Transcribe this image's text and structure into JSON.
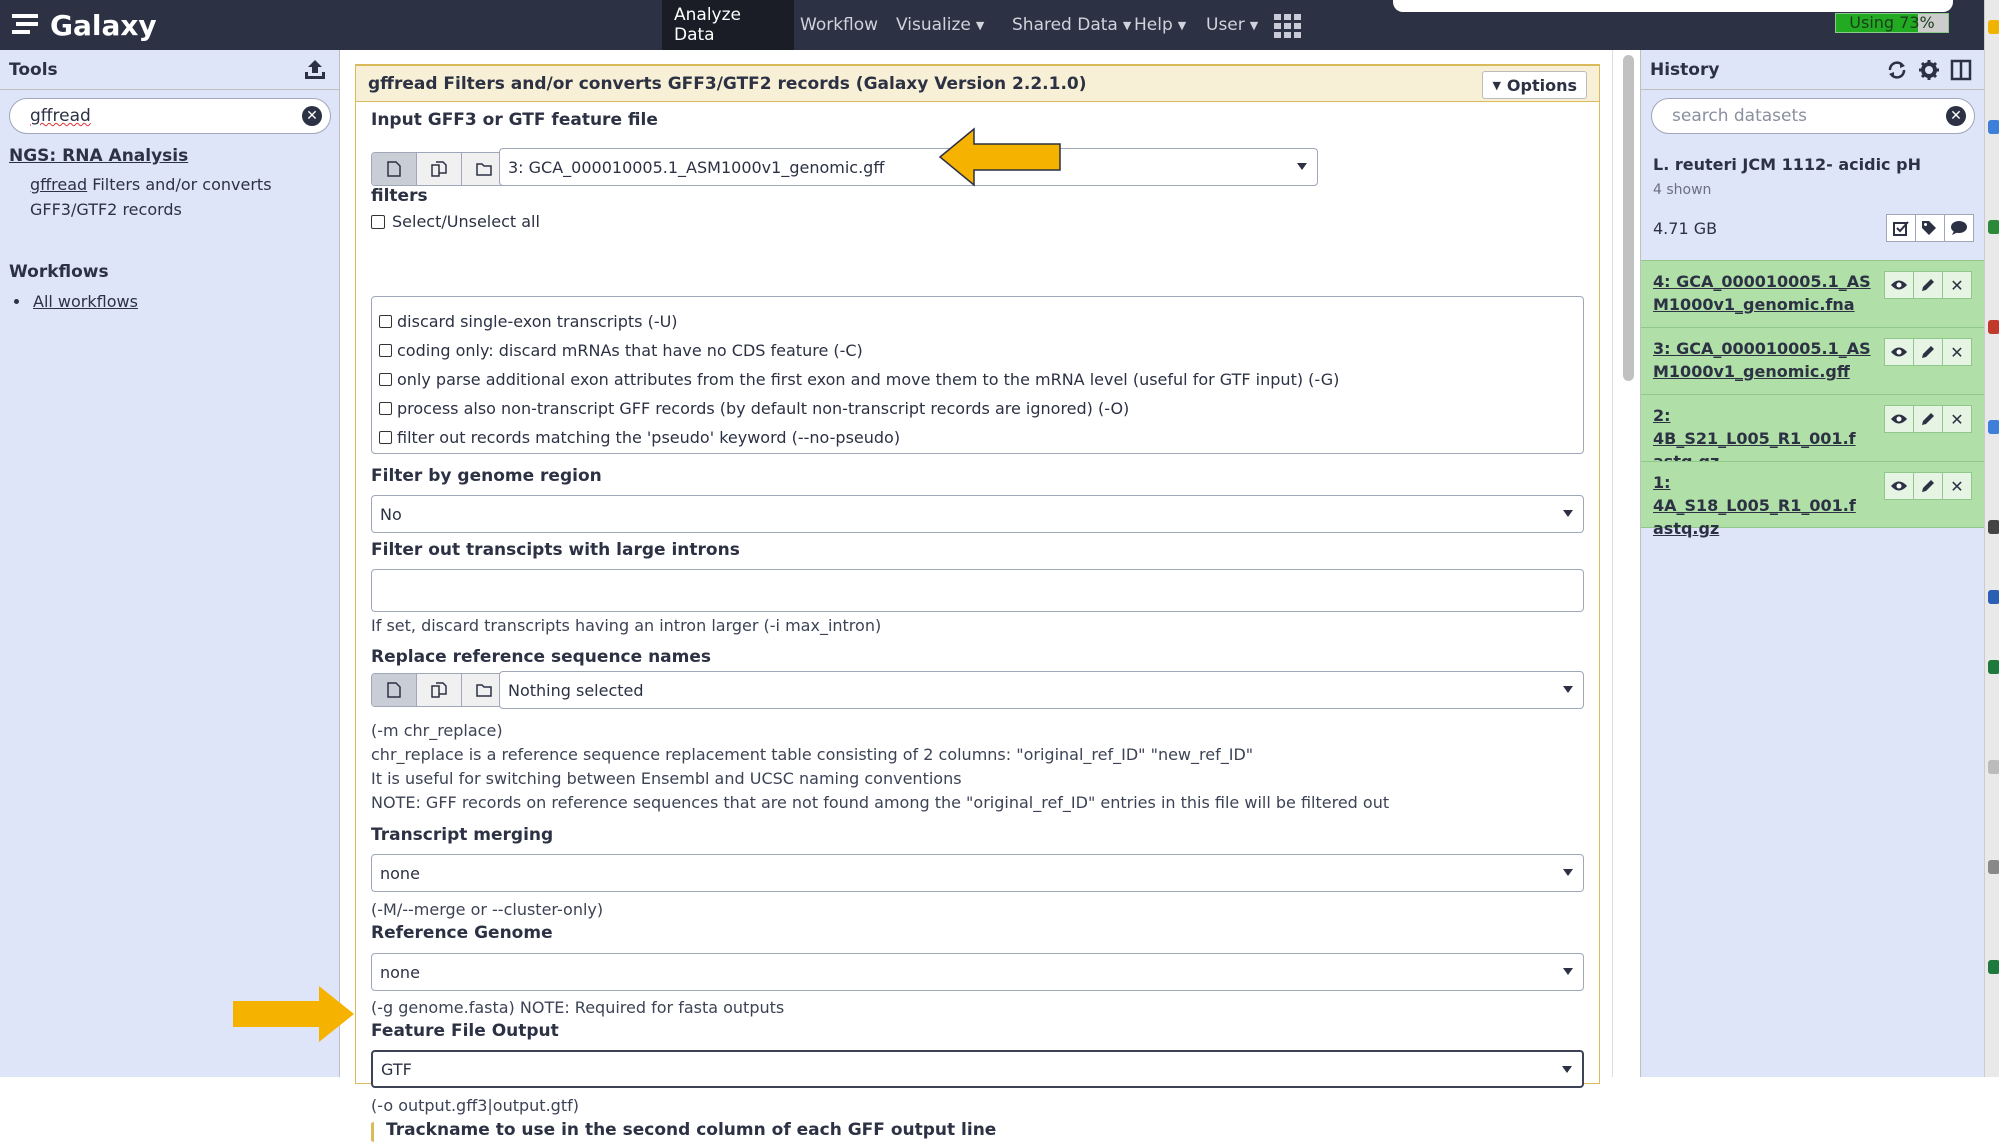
{
  "masthead": {
    "brand": "Galaxy",
    "nav": [
      {
        "label": "Analyze Data",
        "dropdown": false,
        "active": true
      },
      {
        "label": "Workflow",
        "dropdown": false,
        "active": false
      },
      {
        "label": "Visualize",
        "dropdown": true,
        "active": false
      },
      {
        "label": "Shared Data",
        "dropdown": true,
        "active": false
      },
      {
        "label": "Help",
        "dropdown": true,
        "active": false
      },
      {
        "label": "User",
        "dropdown": true,
        "active": false
      }
    ],
    "quota": "Using 73%",
    "quota_percent": 73
  },
  "tools": {
    "title": "Tools",
    "search_value": "gffread",
    "section": "NGS: RNA Analysis",
    "tool_link": "gffread",
    "tool_desc": " Filters and/or converts GFF3/GTF2 records",
    "workflows_title": "Workflows",
    "all_workflows": "All workflows"
  },
  "form": {
    "title": "gffread Filters and/or converts GFF3/GTF2 records (Galaxy Version 2.2.1.0)",
    "options_label": "Options",
    "input_label": "Input GFF3 or GTF feature file",
    "input_value": "3: GCA_000010005.1_ASM1000v1_genomic.gff",
    "filters_label": "filters",
    "select_all": "Select/Unselect all",
    "filters": [
      "discard single-exon transcripts (-U)",
      "coding only: discard mRNAs that have no CDS feature (-C)",
      "only parse additional exon attributes from the first exon and move them to the mRNA level (useful for GTF input) (-G)",
      "process also non-transcript GFF records (by default non-transcript records are ignored) (-O)",
      "filter out records matching the 'pseudo' keyword (--no-pseudo)"
    ],
    "region_label": "Filter by genome region",
    "region_value": "No",
    "introns_label": "Filter out transcipts with large introns",
    "introns_help": "If set, discard transcripts having an intron larger (-i max_intron)",
    "replace_label": "Replace reference sequence names",
    "replace_value": "Nothing selected",
    "replace_help": [
      "(-m chr_replace)",
      "chr_replace is a reference sequence replacement table consisting of 2 columns: \"original_ref_ID\" \"new_ref_ID\"",
      "It is useful for switching between Ensembl and UCSC naming conventions",
      "NOTE: GFF records on reference sequences that are not found among the \"original_ref_ID\" entries in this file will be filtered out"
    ],
    "merge_label": "Transcript merging",
    "merge_value": "none",
    "merge_help": "(-M/--merge or --cluster-only)",
    "genome_label": "Reference Genome",
    "genome_value": "none",
    "genome_help": "(-g genome.fasta) NOTE: Required for fasta outputs",
    "output_label": "Feature File Output",
    "output_value": "GTF",
    "output_help": "(-o output.gff3|output.gtf)",
    "trackname_label": "Trackname to use in the second column of each GFF output line"
  },
  "history": {
    "title": "History",
    "search_placeholder": "search datasets",
    "name": "L. reuteri JCM 1112- acidic pH",
    "shown": "4 shown",
    "size": "4.71 GB",
    "datasets": [
      {
        "line1": "4: GCA_000010005.1_AS",
        "line2": "M1000v1_genomic.fna"
      },
      {
        "line1": "3: GCA_000010005.1_AS",
        "line2": "M1000v1_genomic.gff"
      },
      {
        "line1": "2: 4B_S21_L005_R1_001.f",
        "line2": "astq.gz"
      },
      {
        "line1": "1: 4A_S18_L005_R1_001.f",
        "line2": "astq.gz"
      }
    ]
  },
  "colors": {
    "masthead": "#2c3143",
    "panel_bg": "#dfe5f9",
    "dataset_ok": "#b0e0a8",
    "form_border": "#d9bb5c",
    "arrow": "#f5b300"
  }
}
